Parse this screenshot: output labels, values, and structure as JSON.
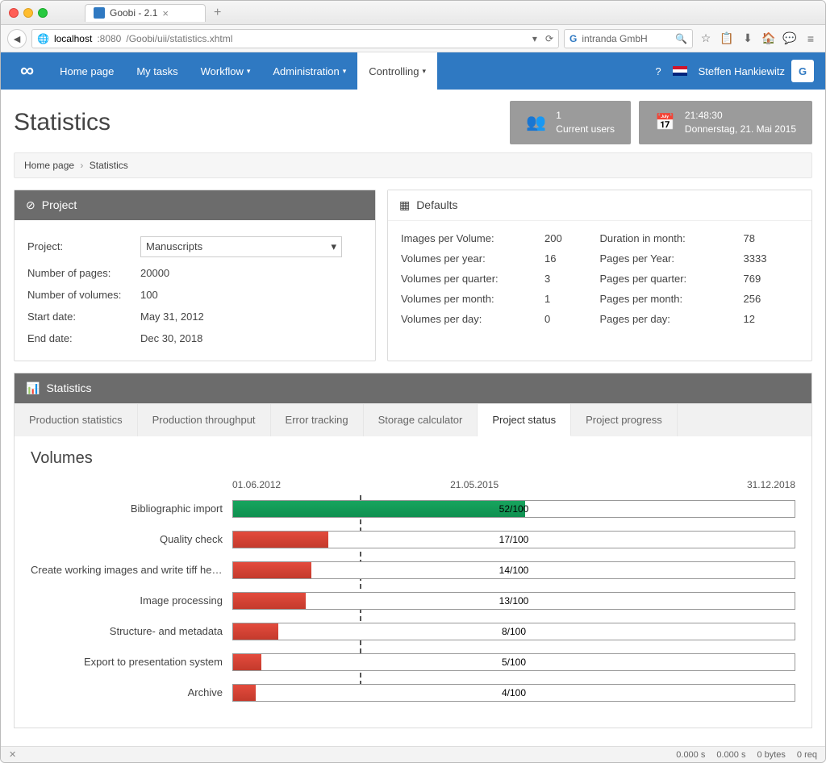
{
  "browser": {
    "tab_title": "Goobi - 2.1",
    "url_host": "localhost",
    "url_port": ":8080",
    "url_path": "/Goobi/uii/statistics.xhtml",
    "search_placeholder": "intranda GmbH"
  },
  "topnav": {
    "items": [
      {
        "label": "Home page"
      },
      {
        "label": "My tasks"
      },
      {
        "label": "Workflow"
      },
      {
        "label": "Administration"
      },
      {
        "label": "Controlling"
      }
    ],
    "user": "Steffen Hankiewitz"
  },
  "header": {
    "page_title": "Statistics",
    "users_card": {
      "count": "1",
      "label": "Current users"
    },
    "clock_card": {
      "time": "21:48:30",
      "date": "Donnerstag, 21. Mai 2015"
    }
  },
  "breadcrumb": {
    "home": "Home page",
    "current": "Statistics"
  },
  "project_panel": {
    "title": "Project",
    "fields": {
      "project_label": "Project:",
      "project_value": "Manuscripts",
      "pages_label": "Number of pages:",
      "pages_value": "20000",
      "volumes_label": "Number of volumes:",
      "volumes_value": "100",
      "start_label": "Start date:",
      "start_value": "May 31, 2012",
      "end_label": "End date:",
      "end_value": "Dec 30, 2018"
    }
  },
  "defaults_panel": {
    "title": "Defaults",
    "rows": {
      "imgv_label": "Images per Volume:",
      "imgv_value": "200",
      "dur_label": "Duration in month:",
      "dur_value": "78",
      "vpy_label": "Volumes per year:",
      "vpy_value": "16",
      "ppy_label": "Pages per Year:",
      "ppy_value": "3333",
      "vpq_label": "Volumes per quarter:",
      "vpq_value": "3",
      "ppq_label": "Pages per quarter:",
      "ppq_value": "769",
      "vpm_label": "Volumes per month:",
      "vpm_value": "1",
      "ppm_label": "Pages per month:",
      "ppm_value": "256",
      "vpd_label": "Volumes per day:",
      "vpd_value": "0",
      "ppd_label": "Pages per day:",
      "ppd_value": "12"
    }
  },
  "stats_panel": {
    "title": "Statistics",
    "tabs": [
      {
        "label": "Production statistics"
      },
      {
        "label": "Production throughput"
      },
      {
        "label": "Error tracking"
      },
      {
        "label": "Storage calculator"
      },
      {
        "label": "Project status"
      },
      {
        "label": "Project progress"
      }
    ],
    "volumes_title": "Volumes",
    "scale": {
      "left": "01.06.2012",
      "mid": "21.05.2015",
      "right": "31.12.2018"
    }
  },
  "chart_data": {
    "type": "bar",
    "title": "Volumes",
    "xlabel": "",
    "ylabel": "",
    "ylim": [
      0,
      100
    ],
    "categories": [
      "Bibliographic import",
      "Quality check",
      "Create working images and write tiff hea…",
      "Image processing",
      "Structure- and metadata",
      "Export to presentation system",
      "Archive"
    ],
    "values": [
      52,
      17,
      14,
      13,
      8,
      5,
      4
    ],
    "value_labels": [
      "52/100",
      "17/100",
      "14/100",
      "13/100",
      "8/100",
      "5/100",
      "4/100"
    ],
    "colors": [
      "green",
      "red",
      "red",
      "red",
      "red",
      "red",
      "red"
    ],
    "today_marker": "21.05.2015",
    "range": {
      "start": "01.06.2012",
      "end": "31.12.2018"
    }
  },
  "statusbar": {
    "t1": "0.000 s",
    "t2": "0.000 s",
    "bytes": "0 bytes",
    "req": "0 req"
  }
}
